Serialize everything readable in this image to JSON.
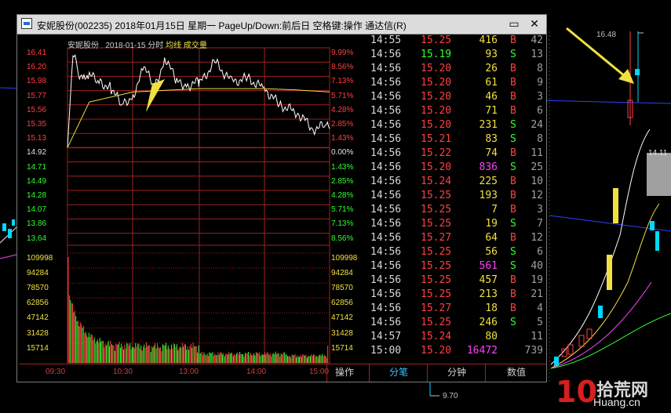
{
  "background": {
    "high_label": "16.48",
    "low_label": "9.70",
    "side_label": "14.11"
  },
  "window": {
    "title": "安妮股份(002235) 2018年01月15日 星期一 PageUp/Down:前后日 空格键:操作 通达信(R)",
    "restore_glyph": "▭",
    "close_glyph": "✕"
  },
  "chart": {
    "stock_name": "安妮股份",
    "date": "2018-01-15",
    "mode": "分时",
    "avg_label": "均线",
    "vol_label": "成交量",
    "prev_close": 14.92,
    "price_ticks": [
      "16.41",
      "16.20",
      "15.98",
      "15.77",
      "15.56",
      "15.35",
      "15.13",
      "14.92",
      "14.71",
      "14.49",
      "14.28",
      "14.07",
      "13.86",
      "13.64"
    ],
    "pct_ticks": [
      "9.99%",
      "8.56%",
      "7.13%",
      "5.71%",
      "4.28%",
      "2.85%",
      "1.43%",
      "0.00%",
      "1.43%",
      "2.85%",
      "4.28%",
      "5.71%",
      "7.13%",
      "8.56%"
    ],
    "vol_ticks": [
      "109998",
      "94284",
      "78570",
      "62856",
      "47142",
      "31428",
      "15714"
    ],
    "time_labels": [
      "09:30",
      "10:30",
      "13:00",
      "14:00",
      "15:00"
    ],
    "colors": {
      "up": "#ff4040",
      "down": "#30ff30",
      "avg": "#f0e040",
      "price": "#ffffff",
      "grid": "#a02020"
    }
  },
  "chart_data": {
    "type": "line",
    "title": "安妮股份 2018-01-15 分时",
    "ylim": [
      13.64,
      16.41
    ],
    "series": [
      {
        "name": "price",
        "x": [
          "09:30",
          "09:35",
          "09:40",
          "09:45",
          "09:50",
          "10:00",
          "10:10",
          "10:20",
          "10:30",
          "10:40",
          "10:50",
          "11:00",
          "11:10",
          "11:20",
          "11:30",
          "13:00",
          "13:15",
          "13:30",
          "13:45",
          "14:00",
          "14:15",
          "14:30",
          "14:45",
          "14:56",
          "15:00"
        ],
        "values": [
          14.92,
          16.35,
          16.05,
          15.95,
          16.0,
          15.9,
          15.8,
          15.55,
          15.7,
          16.1,
          15.85,
          16.25,
          15.9,
          15.85,
          15.9,
          15.85,
          16.2,
          15.9,
          15.95,
          15.8,
          15.55,
          15.45,
          15.2,
          15.25,
          15.2
        ]
      },
      {
        "name": "均线",
        "x": [
          "09:30",
          "09:50",
          "10:30",
          "11:30",
          "13:30",
          "14:00",
          "14:30",
          "15:00"
        ],
        "values": [
          14.92,
          15.6,
          15.75,
          15.8,
          15.8,
          15.8,
          15.78,
          15.75
        ]
      }
    ]
  },
  "trades": [
    {
      "time": "14:55",
      "price": "15.25",
      "vol": "416",
      "dir": "B",
      "n": "42"
    },
    {
      "time": "14:56",
      "price": "15.19",
      "vol": "93",
      "dir": "S",
      "n": "13"
    },
    {
      "time": "14:56",
      "price": "15.20",
      "vol": "26",
      "dir": "B",
      "n": "8"
    },
    {
      "time": "14:56",
      "price": "15.20",
      "vol": "61",
      "dir": "B",
      "n": "9"
    },
    {
      "time": "14:56",
      "price": "15.20",
      "vol": "46",
      "dir": "B",
      "n": "3"
    },
    {
      "time": "14:56",
      "price": "15.20",
      "vol": "71",
      "dir": "B",
      "n": "6"
    },
    {
      "time": "14:56",
      "price": "15.20",
      "vol": "231",
      "dir": "S",
      "n": "24"
    },
    {
      "time": "14:56",
      "price": "15.21",
      "vol": "83",
      "dir": "S",
      "n": "8"
    },
    {
      "time": "14:56",
      "price": "15.22",
      "vol": "74",
      "dir": "B",
      "n": "11"
    },
    {
      "time": "14:56",
      "price": "15.20",
      "vol": "836",
      "dir": "S",
      "n": "25"
    },
    {
      "time": "14:56",
      "price": "15.24",
      "vol": "225",
      "dir": "B",
      "n": "10"
    },
    {
      "time": "14:56",
      "price": "15.25",
      "vol": "193",
      "dir": "B",
      "n": "12"
    },
    {
      "time": "14:56",
      "price": "15.25",
      "vol": "7",
      "dir": "B",
      "n": "3"
    },
    {
      "time": "14:56",
      "price": "15.25",
      "vol": "19",
      "dir": "S",
      "n": "7"
    },
    {
      "time": "14:56",
      "price": "15.27",
      "vol": "64",
      "dir": "B",
      "n": "12"
    },
    {
      "time": "14:56",
      "price": "15.25",
      "vol": "56",
      "dir": "S",
      "n": "6"
    },
    {
      "time": "14:56",
      "price": "15.25",
      "vol": "561",
      "dir": "S",
      "n": "40"
    },
    {
      "time": "14:56",
      "price": "15.25",
      "vol": "457",
      "dir": "B",
      "n": "19"
    },
    {
      "time": "14:56",
      "price": "15.25",
      "vol": "213",
      "dir": "B",
      "n": "21"
    },
    {
      "time": "14:56",
      "price": "15.27",
      "vol": "18",
      "dir": "B",
      "n": "4"
    },
    {
      "time": "14:56",
      "price": "15.25",
      "vol": "246",
      "dir": "S",
      "n": "5"
    },
    {
      "time": "14:57",
      "price": "15.24",
      "vol": "80",
      "dir": "",
      "n": "11"
    },
    {
      "time": "15:00",
      "price": "15.20",
      "vol": "16472",
      "dir": "",
      "n": "739"
    }
  ],
  "tabs": [
    {
      "label": "操作"
    },
    {
      "label": "分笔"
    },
    {
      "label": "分钟"
    },
    {
      "label": "数值"
    }
  ],
  "watermark": {
    "num": "10",
    "cn": "拾荒网",
    "en": "Huang.cn"
  }
}
